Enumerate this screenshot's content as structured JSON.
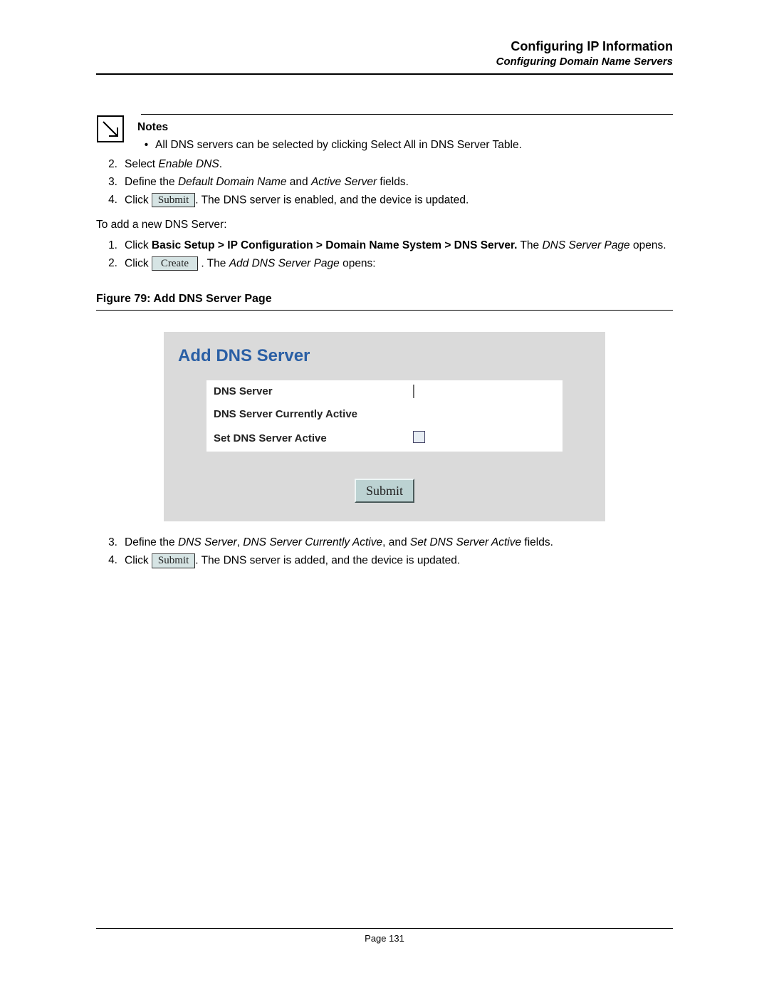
{
  "header": {
    "title": "Configuring IP Information",
    "subtitle": "Configuring Domain Name Servers"
  },
  "notes": {
    "label": "Notes",
    "bullet": "All DNS servers can be selected by clicking Select All in DNS Server Table."
  },
  "steps_a": {
    "s2_pre": "Select ",
    "s2_em": "Enable DNS",
    "s2_post": ".",
    "s3_pre": "Define the ",
    "s3_em1": "Default Domain Name",
    "s3_mid": " and ",
    "s3_em2": "Active Server",
    "s3_post": " fields.",
    "s4_pre": "Click  ",
    "s4_btn": "Submit",
    "s4_post": ". The DNS server is enabled, and the device is updated."
  },
  "para1": "To add a new DNS Server:",
  "steps_b": {
    "s1_pre": "Click ",
    "s1_bold": "Basic Setup > IP Configuration > Domain Name System > DNS Server.",
    "s1_mid": " The ",
    "s1_em": "DNS Server Page",
    "s1_post": " opens.",
    "s2_pre": "Click  ",
    "s2_btn": "Create",
    "s2_mid": " . The ",
    "s2_em": "Add DNS Server Page",
    "s2_post": " opens:"
  },
  "figure": {
    "caption": "Figure 79:  Add DNS Server Page",
    "panel_title": "Add DNS Server",
    "row1": "DNS Server",
    "row2": "DNS Server Currently Active",
    "row3": "Set DNS Server Active",
    "submit": "Submit"
  },
  "steps_c": {
    "s3_pre": "Define the ",
    "s3_em1": "DNS Server",
    "s3_c1": ", ",
    "s3_em2": "DNS Server Currently Active",
    "s3_c2": ", and ",
    "s3_em3": "Set DNS Server Active",
    "s3_post": " fields.",
    "s4_pre": "Click  ",
    "s4_btn": "Submit",
    "s4_post": ". The DNS server is added, and the device is updated."
  },
  "footer": {
    "page": "Page 131"
  }
}
